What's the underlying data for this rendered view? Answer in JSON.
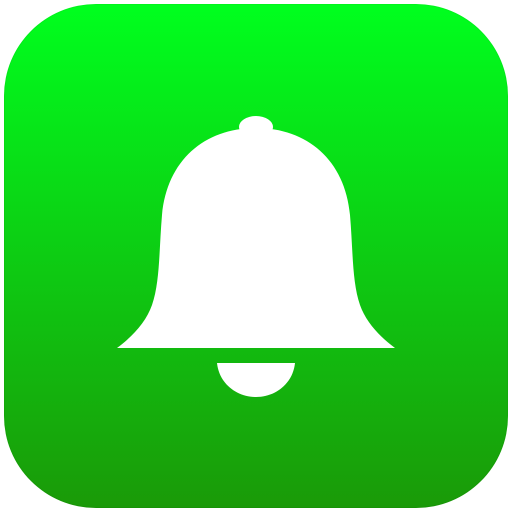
{
  "app_icon": {
    "icon": "bell-icon",
    "colors": {
      "gradient_top": "#00ff1e",
      "gradient_bottom": "#1a9a08",
      "glyph": "#ffffff",
      "page_background": "#ffffff"
    }
  }
}
